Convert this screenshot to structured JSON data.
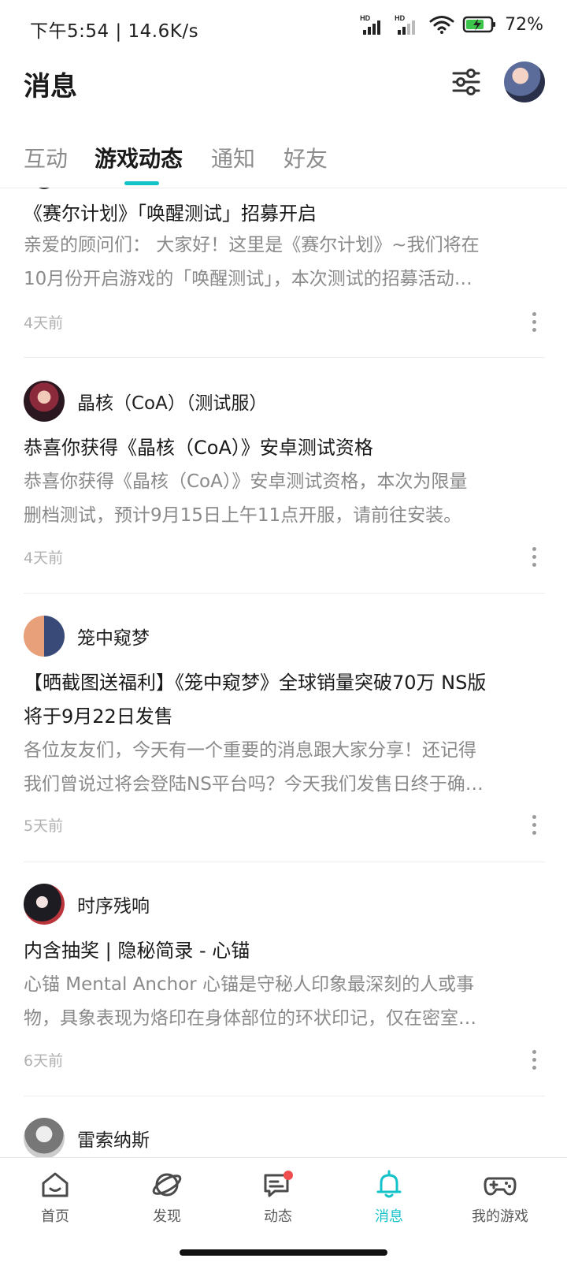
{
  "status_bar": {
    "time_and_speed": "下午5:54 | 14.6K/s",
    "network_labels": [
      "HD",
      "HD"
    ],
    "battery_percent": "72%"
  },
  "header": {
    "title": "消息",
    "icons": [
      "filter-icon",
      "avatar"
    ]
  },
  "tabs": [
    {
      "label": "互动",
      "active": false
    },
    {
      "label": "游戏动态",
      "active": true
    },
    {
      "label": "通知",
      "active": false
    },
    {
      "label": "好友",
      "active": false
    }
  ],
  "feed": [
    {
      "author": "",
      "title": "《赛尔计划》「唤醒测试」招募开启",
      "body_lines": [
        "亲爱的顾问们： 大家好！这里是《赛尔计划》~我们将在",
        "10月份开启游戏的「唤醒测试」，本次测试的招募活动…"
      ],
      "time": "4天前"
    },
    {
      "author": "晶核（CoA）（测试服）",
      "title": "恭喜你获得《晶核（CoA）》安卓测试资格",
      "body_lines": [
        "恭喜你获得《晶核（CoA）》安卓测试资格，本次为限量",
        "删档测试，预计9月15日上午11点开服，请前往安装。"
      ],
      "time": "4天前"
    },
    {
      "author": "笼中窥梦",
      "title_lines": [
        "【晒截图送福利】《笼中窥梦》全球销量突破70万 NS版",
        "将于9月22日发售"
      ],
      "body_lines": [
        "各位友友们，今天有一个重要的消息跟大家分享！还记得",
        "我们曾说过将会登陆NS平台吗？今天我们发售日终于确…"
      ],
      "time": "5天前"
    },
    {
      "author": "时序残响",
      "title": "内含抽奖 | 隐秘简录 - 心锚",
      "body_lines": [
        "心锚  Mental Anchor  心锚是守秘人印象最深刻的人或事",
        "物，具象表现为烙印在身体部位的环状印记，仅在密室…"
      ],
      "time": "6天前"
    },
    {
      "author": "雷索纳斯"
    }
  ],
  "bottom_nav": [
    {
      "label": "首页",
      "icon": "home-icon",
      "active": false
    },
    {
      "label": "发现",
      "icon": "discover-icon",
      "active": false
    },
    {
      "label": "动态",
      "icon": "moments-icon",
      "active": false,
      "badge": true
    },
    {
      "label": "消息",
      "icon": "bell-icon",
      "active": true
    },
    {
      "label": "我的游戏",
      "icon": "gamepad-icon",
      "active": false
    }
  ],
  "colors": {
    "accent": "#14c2c9",
    "badge": "#f04e4e",
    "secondary_text": "#8a8a8a"
  }
}
